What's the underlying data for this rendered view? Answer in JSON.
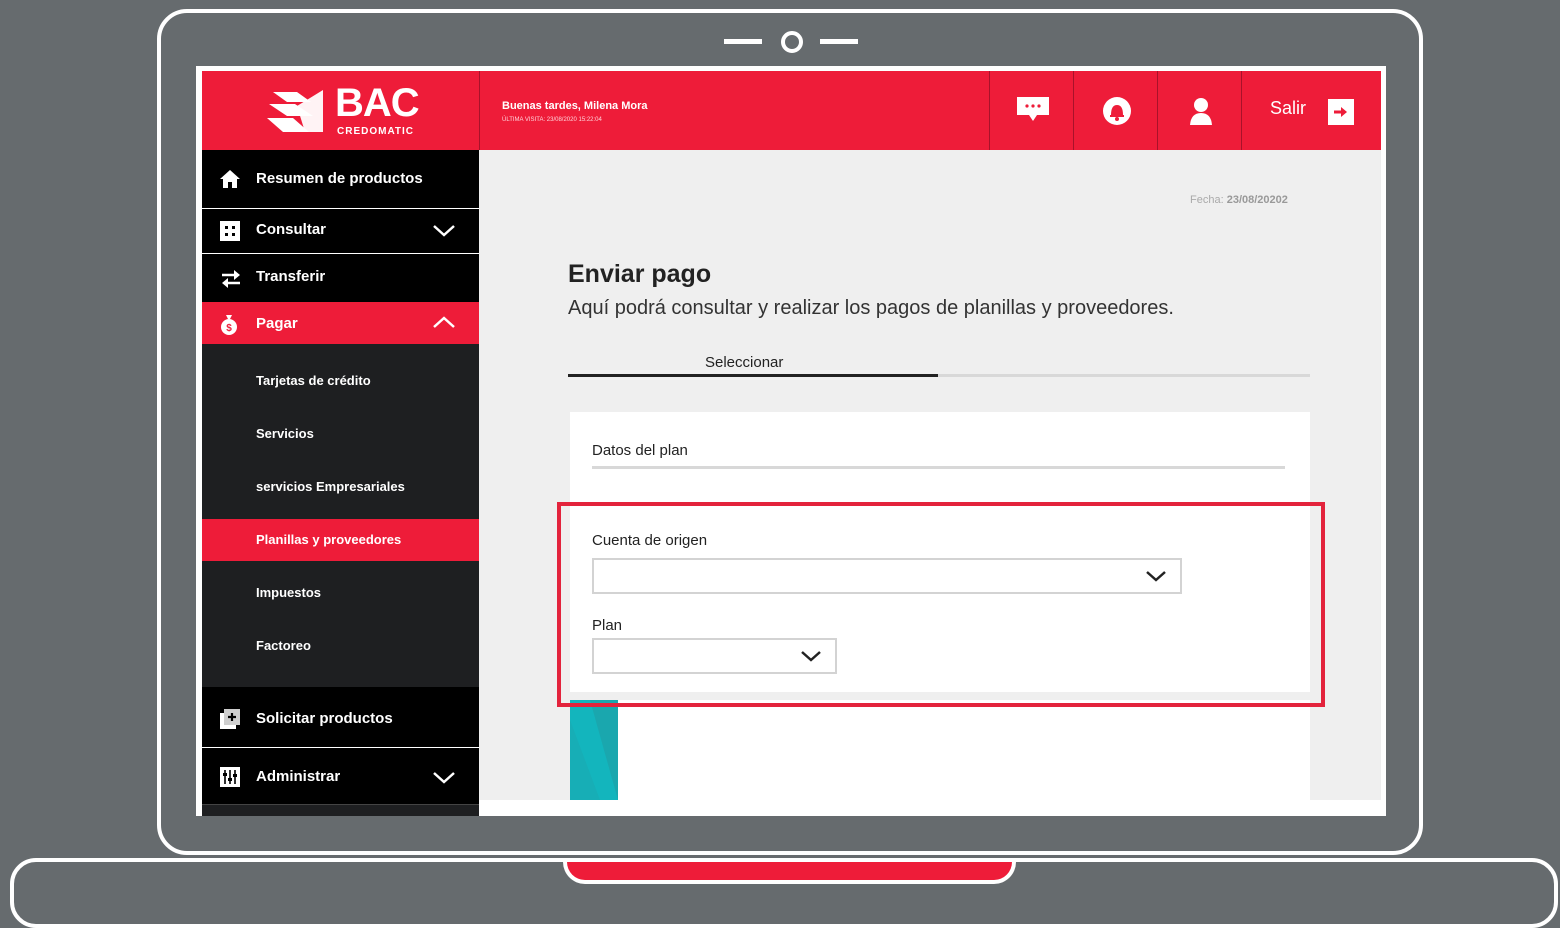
{
  "header": {
    "logo_text": "BAC",
    "logo_sub": "CREDOMATIC",
    "greeting": "Buenas tardes, Milena Mora",
    "last_visit": "ÚLTIMA VISITA: 23/08/2020 15:22:04",
    "buttons": [
      "message-icon",
      "bell-icon",
      "user-icon"
    ],
    "logout_label": "Salir"
  },
  "sidebar": {
    "items": [
      {
        "label": "Resumen de productos",
        "icon": "home-icon"
      },
      {
        "label": "Consultar",
        "icon": "grid-icon"
      },
      {
        "label": "Transferir",
        "icon": "transfer-icon"
      },
      {
        "label": "Pagar",
        "icon": "money-bag-icon"
      },
      {
        "label": "Solicitar productos",
        "icon": "add-box-icon"
      },
      {
        "label": "Administrar",
        "icon": "sliders-icon"
      }
    ],
    "subitems": [
      "Tarjetas de crédito",
      "Servicios",
      "servicios Empresariales",
      "Planillas y proveedores",
      "Impuestos",
      "Factoreo"
    ]
  },
  "main": {
    "date_label": "Fecha:",
    "date_value": "23/08/20202",
    "title": "Enviar pago",
    "subtitle": "Aquí podrá consultar y realizar los pagos de planillas y proveedores.",
    "tab_label": "Seleccionar",
    "card_title": "Datos del plan",
    "field_origin_label": "Cuenta de origen",
    "field_origin_value": "",
    "field_plan_label": "Plan",
    "field_plan_value": ""
  },
  "colors": {
    "brand": "#ee1c39",
    "highlight": "#e3233c",
    "teal": "#13b5bd"
  }
}
